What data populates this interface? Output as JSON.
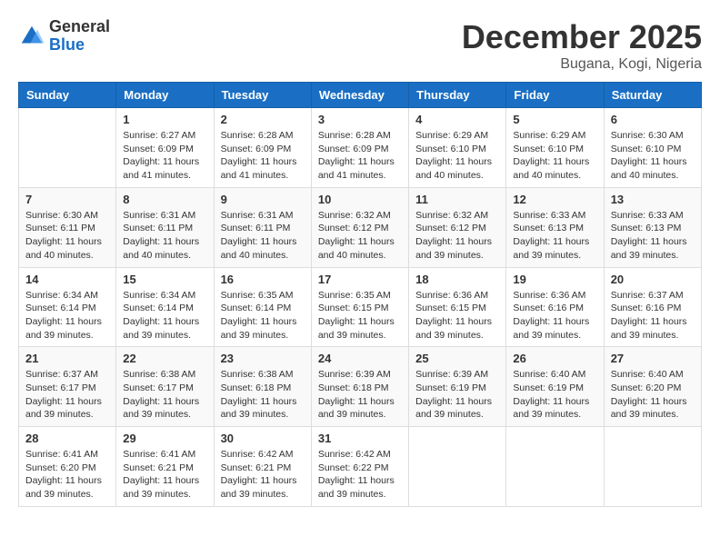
{
  "logo": {
    "general": "General",
    "blue": "Blue"
  },
  "title": "December 2025",
  "location": "Bugana, Kogi, Nigeria",
  "weekdays": [
    "Sunday",
    "Monday",
    "Tuesday",
    "Wednesday",
    "Thursday",
    "Friday",
    "Saturday"
  ],
  "weeks": [
    [
      {
        "day": "",
        "info": ""
      },
      {
        "day": "1",
        "info": "Sunrise: 6:27 AM\nSunset: 6:09 PM\nDaylight: 11 hours and 41 minutes."
      },
      {
        "day": "2",
        "info": "Sunrise: 6:28 AM\nSunset: 6:09 PM\nDaylight: 11 hours and 41 minutes."
      },
      {
        "day": "3",
        "info": "Sunrise: 6:28 AM\nSunset: 6:09 PM\nDaylight: 11 hours and 41 minutes."
      },
      {
        "day": "4",
        "info": "Sunrise: 6:29 AM\nSunset: 6:10 PM\nDaylight: 11 hours and 40 minutes."
      },
      {
        "day": "5",
        "info": "Sunrise: 6:29 AM\nSunset: 6:10 PM\nDaylight: 11 hours and 40 minutes."
      },
      {
        "day": "6",
        "info": "Sunrise: 6:30 AM\nSunset: 6:10 PM\nDaylight: 11 hours and 40 minutes."
      }
    ],
    [
      {
        "day": "7",
        "info": "Sunrise: 6:30 AM\nSunset: 6:11 PM\nDaylight: 11 hours and 40 minutes."
      },
      {
        "day": "8",
        "info": "Sunrise: 6:31 AM\nSunset: 6:11 PM\nDaylight: 11 hours and 40 minutes."
      },
      {
        "day": "9",
        "info": "Sunrise: 6:31 AM\nSunset: 6:11 PM\nDaylight: 11 hours and 40 minutes."
      },
      {
        "day": "10",
        "info": "Sunrise: 6:32 AM\nSunset: 6:12 PM\nDaylight: 11 hours and 40 minutes."
      },
      {
        "day": "11",
        "info": "Sunrise: 6:32 AM\nSunset: 6:12 PM\nDaylight: 11 hours and 39 minutes."
      },
      {
        "day": "12",
        "info": "Sunrise: 6:33 AM\nSunset: 6:13 PM\nDaylight: 11 hours and 39 minutes."
      },
      {
        "day": "13",
        "info": "Sunrise: 6:33 AM\nSunset: 6:13 PM\nDaylight: 11 hours and 39 minutes."
      }
    ],
    [
      {
        "day": "14",
        "info": "Sunrise: 6:34 AM\nSunset: 6:14 PM\nDaylight: 11 hours and 39 minutes."
      },
      {
        "day": "15",
        "info": "Sunrise: 6:34 AM\nSunset: 6:14 PM\nDaylight: 11 hours and 39 minutes."
      },
      {
        "day": "16",
        "info": "Sunrise: 6:35 AM\nSunset: 6:14 PM\nDaylight: 11 hours and 39 minutes."
      },
      {
        "day": "17",
        "info": "Sunrise: 6:35 AM\nSunset: 6:15 PM\nDaylight: 11 hours and 39 minutes."
      },
      {
        "day": "18",
        "info": "Sunrise: 6:36 AM\nSunset: 6:15 PM\nDaylight: 11 hours and 39 minutes."
      },
      {
        "day": "19",
        "info": "Sunrise: 6:36 AM\nSunset: 6:16 PM\nDaylight: 11 hours and 39 minutes."
      },
      {
        "day": "20",
        "info": "Sunrise: 6:37 AM\nSunset: 6:16 PM\nDaylight: 11 hours and 39 minutes."
      }
    ],
    [
      {
        "day": "21",
        "info": "Sunrise: 6:37 AM\nSunset: 6:17 PM\nDaylight: 11 hours and 39 minutes."
      },
      {
        "day": "22",
        "info": "Sunrise: 6:38 AM\nSunset: 6:17 PM\nDaylight: 11 hours and 39 minutes."
      },
      {
        "day": "23",
        "info": "Sunrise: 6:38 AM\nSunset: 6:18 PM\nDaylight: 11 hours and 39 minutes."
      },
      {
        "day": "24",
        "info": "Sunrise: 6:39 AM\nSunset: 6:18 PM\nDaylight: 11 hours and 39 minutes."
      },
      {
        "day": "25",
        "info": "Sunrise: 6:39 AM\nSunset: 6:19 PM\nDaylight: 11 hours and 39 minutes."
      },
      {
        "day": "26",
        "info": "Sunrise: 6:40 AM\nSunset: 6:19 PM\nDaylight: 11 hours and 39 minutes."
      },
      {
        "day": "27",
        "info": "Sunrise: 6:40 AM\nSunset: 6:20 PM\nDaylight: 11 hours and 39 minutes."
      }
    ],
    [
      {
        "day": "28",
        "info": "Sunrise: 6:41 AM\nSunset: 6:20 PM\nDaylight: 11 hours and 39 minutes."
      },
      {
        "day": "29",
        "info": "Sunrise: 6:41 AM\nSunset: 6:21 PM\nDaylight: 11 hours and 39 minutes."
      },
      {
        "day": "30",
        "info": "Sunrise: 6:42 AM\nSunset: 6:21 PM\nDaylight: 11 hours and 39 minutes."
      },
      {
        "day": "31",
        "info": "Sunrise: 6:42 AM\nSunset: 6:22 PM\nDaylight: 11 hours and 39 minutes."
      },
      {
        "day": "",
        "info": ""
      },
      {
        "day": "",
        "info": ""
      },
      {
        "day": "",
        "info": ""
      }
    ]
  ]
}
